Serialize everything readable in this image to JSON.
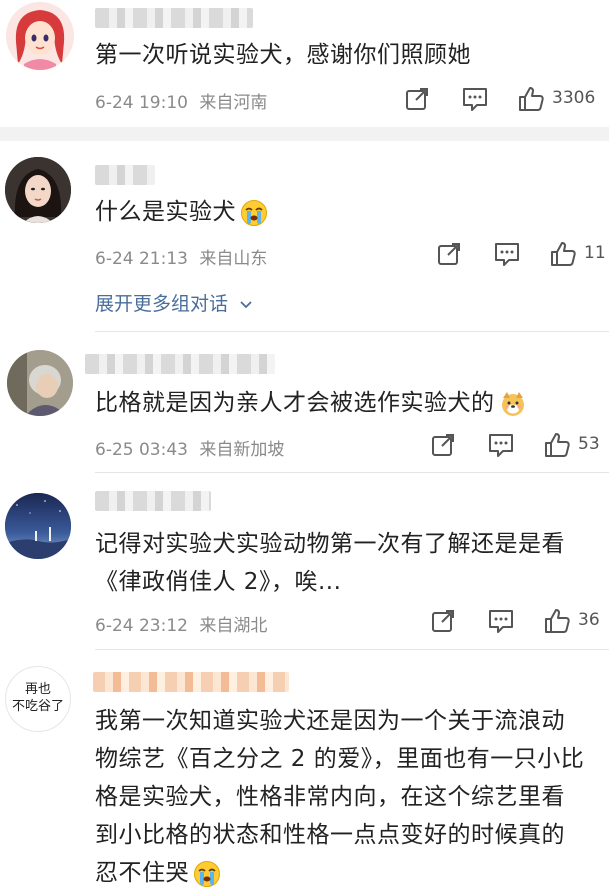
{
  "comments": [
    {
      "text": "第一次听说实验犬，感谢你们照顾她",
      "time": "6-24 19:10",
      "location": "来自河南",
      "likes": "3306",
      "avatar_icon": "cartoon-girl-avatar"
    },
    {
      "text": "什么是实验犬",
      "emoji": "crying-face-icon",
      "time": "6-24 21:13",
      "location": "来自山东",
      "likes": "11",
      "expand_label": "展开更多组对话",
      "avatar_icon": "woman-photo-avatar"
    },
    {
      "text": "比格就是因为亲人才会被选作实验犬的",
      "emoji": "dog-face-icon",
      "time": "6-25 03:43",
      "location": "来自新加坡",
      "likes": "53",
      "avatar_icon": "old-person-photo-avatar"
    },
    {
      "text_line1": "记得对实验犬实验动物第一次有了解还是是看",
      "text_line2": "《律政俏佳人 2》，唉...",
      "time": "6-24 23:12",
      "location": "来自湖北",
      "likes": "36",
      "avatar_icon": "night-sky-avatar"
    },
    {
      "avatar_line1": "再也",
      "avatar_line2": "不吃谷了",
      "text_line1": "我第一次知道实验犬还是因为一个关于流浪动",
      "text_line2": "物综艺《百之分之 2 的爱》，里面也有一只小比",
      "text_line3": "格是实验犬，性格非常内向，在这个综艺里看",
      "text_line4": "到小比格的状态和性格一点点变好的时候真的",
      "text_line5": "忍不住哭",
      "emoji": "crying-face-icon"
    }
  ],
  "colors": {
    "meta": "#8a8a8a",
    "link": "#4a6e9c",
    "separator": "#f2f2f2"
  }
}
